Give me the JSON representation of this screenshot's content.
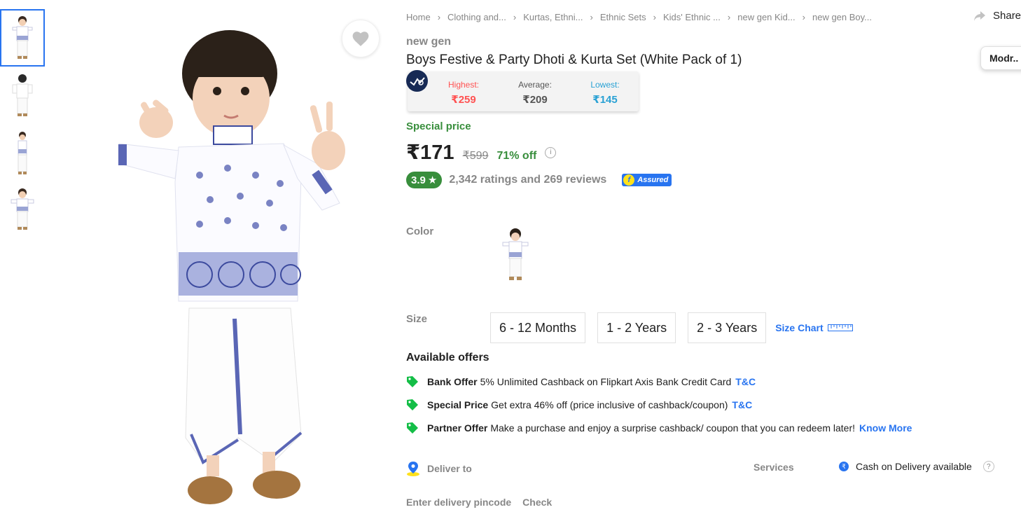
{
  "breadcrumb": [
    "Home",
    "Clothing and...",
    "Kurtas, Ethni...",
    "Ethnic Sets",
    "Kids' Ethnic ...",
    "new gen Kid...",
    "new gen Boy..."
  ],
  "share_label": "Share",
  "floating_button": "Modr..",
  "product": {
    "brand": "new gen",
    "title": "Boys Festive & Party Dhoti & Kurta Set  (White Pack of 1)"
  },
  "price_history": {
    "highest_label": "Highest:",
    "highest_value": "₹259",
    "average_label": "Average:",
    "average_value": "₹209",
    "lowest_label": "Lowest:",
    "lowest_value": "₹145"
  },
  "special_price_label": "Special price",
  "pricing": {
    "price": "₹171",
    "mrp": "₹599",
    "discount": "71% off"
  },
  "rating": {
    "score": "3.9",
    "summary": "2,342 ratings and 269 reviews",
    "assured": "Assured"
  },
  "color_label": "Color",
  "size_label": "Size",
  "sizes": [
    "6 - 12 Months",
    "1 - 2 Years",
    "2 - 3 Years"
  ],
  "size_chart_label": "Size Chart",
  "offers": {
    "heading": "Available offers",
    "items": [
      {
        "title": "Bank Offer",
        "text": "5% Unlimited Cashback on Flipkart Axis Bank Credit Card",
        "link": "T&C"
      },
      {
        "title": "Special Price",
        "text": "Get extra 46% off (price inclusive of cashback/coupon)",
        "link": "T&C"
      },
      {
        "title": "Partner Offer",
        "text": "Make a purchase and enjoy a surprise cashback/ coupon that you can redeem later!",
        "link": "Know More"
      }
    ]
  },
  "delivery": {
    "deliver_to": "Deliver to",
    "pincode_placeholder": "Enter delivery pincode",
    "check": "Check",
    "services_label": "Services",
    "cod": "Cash on Delivery available"
  },
  "colors": {
    "accent": "#2874f0",
    "green": "#388e3c",
    "highest": "#ff5252",
    "lowest": "#29a1d4"
  }
}
